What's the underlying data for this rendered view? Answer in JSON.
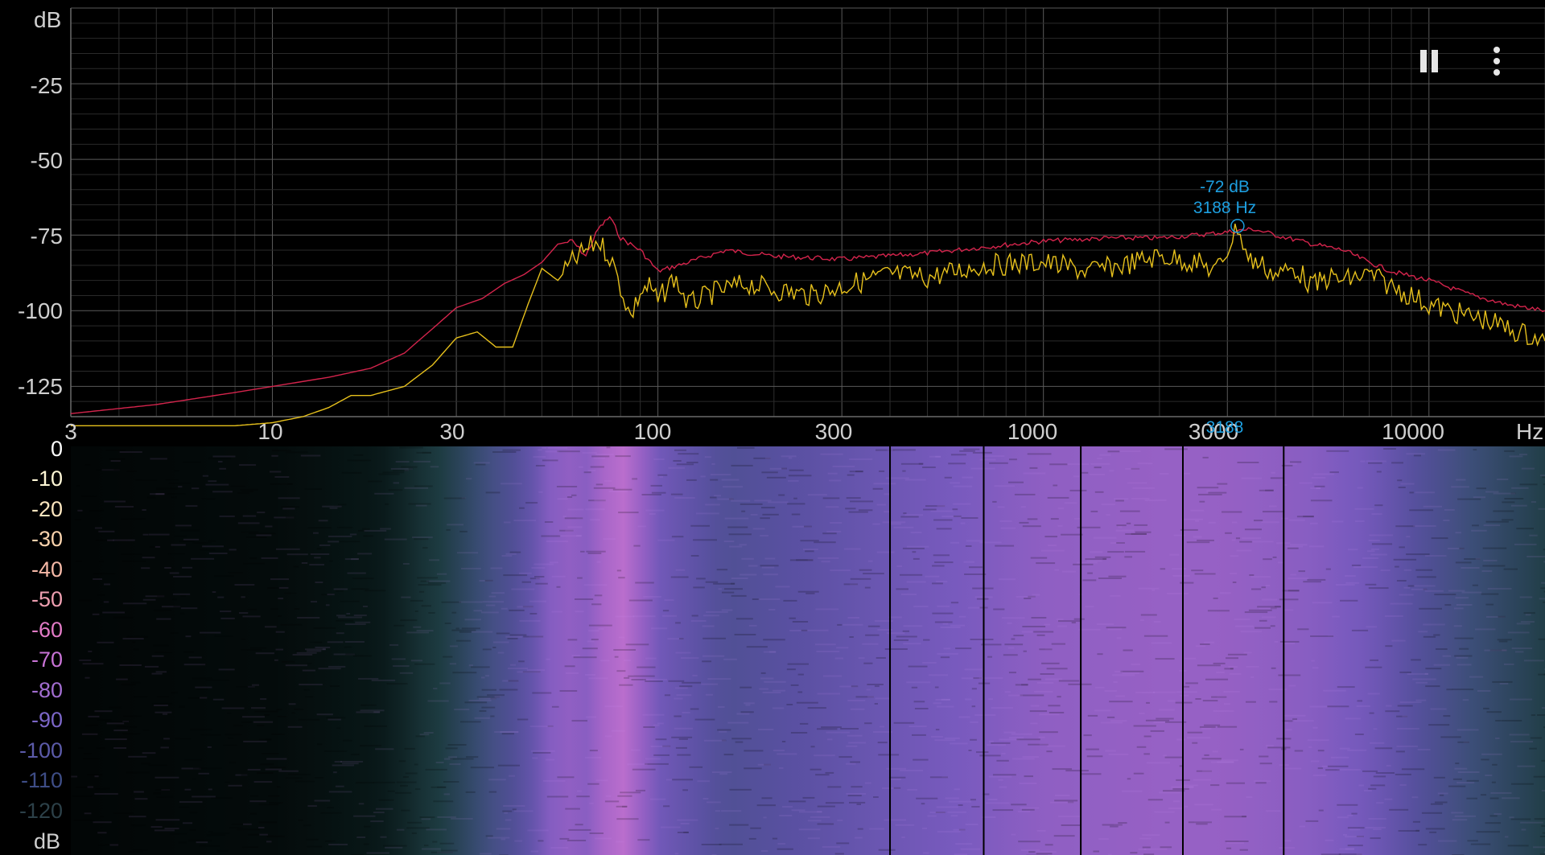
{
  "chart_data": [
    {
      "type": "line",
      "title": "",
      "xlabel": "Hz",
      "ylabel": "dB",
      "x_scale": "log",
      "xlim": [
        3,
        20000
      ],
      "ylim": [
        -135,
        0
      ],
      "grid": true,
      "x_tick_labels": [
        "3",
        "10",
        "30",
        "100",
        "300",
        "1000",
        "3000",
        "10000"
      ],
      "y_tick_labels": [
        "-25",
        "-50",
        "-75",
        "-100",
        "-125"
      ],
      "series": [
        {
          "color": "#d4244c",
          "x": [
            3,
            5,
            8,
            10,
            14,
            18,
            22,
            26,
            30,
            35,
            40,
            45,
            50,
            55,
            60,
            65,
            70,
            75,
            80,
            90,
            100,
            120,
            150,
            200,
            300,
            500,
            700,
            1000,
            1500,
            2000,
            2500,
            3000,
            3500,
            4000,
            5000,
            6000,
            7000,
            8000,
            10000,
            13000,
            16000,
            20000
          ],
          "y": [
            -134,
            -131,
            -127,
            -125,
            -122,
            -119,
            -114,
            -106,
            -99,
            -96,
            -91,
            -88,
            -84,
            -78,
            -77,
            -82,
            -73,
            -69,
            -76,
            -80,
            -87,
            -84,
            -80,
            -82,
            -83,
            -81,
            -79,
            -77,
            -76,
            -76,
            -75,
            -74,
            -73,
            -75,
            -78,
            -80,
            -84,
            -87,
            -90,
            -95,
            -98,
            -100
          ]
        },
        {
          "color": "#e6c01c",
          "x": [
            3,
            8,
            10,
            12,
            14,
            16,
            18,
            22,
            26,
            30,
            34,
            38,
            42,
            46,
            50,
            55,
            60,
            65,
            70,
            75,
            80,
            85,
            90,
            95,
            100,
            110,
            120,
            140,
            170,
            200,
            250,
            300,
            400,
            500,
            700,
            1000,
            1300,
            1600,
            2000,
            2500,
            2800,
            3000,
            3188,
            3400,
            3700,
            4000,
            4500,
            5000,
            5500,
            6000,
            7000,
            8000,
            9000,
            10000,
            12000,
            14000,
            16000,
            18000,
            20000
          ],
          "y": [
            -138,
            -138,
            -137,
            -135,
            -132,
            -128,
            -128,
            -125,
            -118,
            -109,
            -107,
            -112,
            -112,
            -98,
            -86,
            -90,
            -84,
            -80,
            -77,
            -82,
            -92,
            -102,
            -94,
            -92,
            -97,
            -89,
            -98,
            -94,
            -91,
            -93,
            -95,
            -92,
            -88,
            -89,
            -85,
            -84,
            -87,
            -85,
            -82,
            -84,
            -87,
            -80,
            -72,
            -83,
            -85,
            -88,
            -86,
            -92,
            -89,
            -90,
            -88,
            -92,
            -95,
            -98,
            -101,
            -103,
            -106,
            -108,
            -110
          ]
        }
      ],
      "annotations": [
        {
          "text": "-72 dB",
          "x": 3188,
          "y": -72
        },
        {
          "text": "3188 Hz",
          "x": 3188,
          "y": -72
        }
      ]
    },
    {
      "type": "heatmap",
      "title": "",
      "xlabel": "",
      "x_scale": "log",
      "xlim": [
        3,
        20000
      ],
      "colorbar_label": "dB",
      "colorbar_ticks": [
        "0",
        "-10",
        "-20",
        "-30",
        "-40",
        "-50",
        "-60",
        "-70",
        "-80",
        "-90",
        "-100",
        "-110",
        "-120"
      ],
      "intensity_profile": {
        "x": [
          3,
          10,
          20,
          28,
          36,
          45,
          55,
          65,
          80,
          100,
          150,
          300,
          400,
          600,
          1000,
          2000,
          3000,
          5000,
          7000,
          10000,
          15000,
          20000
        ],
        "db": [
          -135,
          -130,
          -118,
          -104,
          -94,
          -88,
          -78,
          -80,
          -72,
          -83,
          -90,
          -86,
          -84,
          -82,
          -79,
          -78,
          -78,
          -80,
          -83,
          -90,
          -98,
          -104
        ]
      },
      "vertical_markers_hz": [
        400,
        700,
        1250,
        2300,
        4200
      ]
    }
  ],
  "labels": {
    "db_unit_top": "dB",
    "db_unit_bottom": "dB",
    "hz_unit": "Hz",
    "peak_db": "-72 dB",
    "peak_hz": "3188 Hz",
    "marker_hz": "3188"
  },
  "controls": {
    "pause_icon": "pause-icon",
    "menu_icon": "more-vert-icon"
  },
  "colors": {
    "background": "#000000",
    "grid": "#3a3a3a",
    "axis_text": "#cfcfcf",
    "peak_marker": "#1d9fe0",
    "max_hold_line": "#d4244c",
    "live_line": "#e6c01c"
  },
  "scale_colors": [
    "#ffffff",
    "#fff7d6",
    "#fde6bf",
    "#fbd3ad",
    "#f5b8a6",
    "#ee9fb0",
    "#e27bc6",
    "#c873d6",
    "#a26dd0",
    "#7c66c8",
    "#5b5aa8",
    "#3e4d86",
    "#2c4048"
  ]
}
